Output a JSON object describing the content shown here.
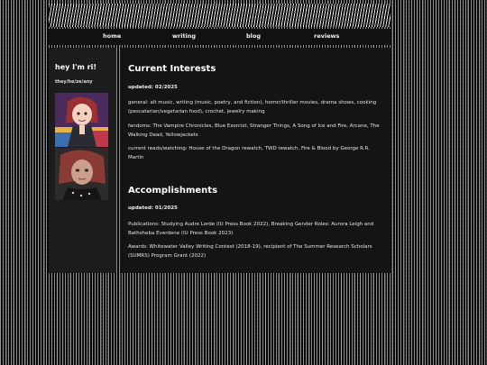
{
  "nav": {
    "items": [
      {
        "label": "home"
      },
      {
        "label": "writing"
      },
      {
        "label": "blog"
      },
      {
        "label": "reviews"
      }
    ]
  },
  "sidebar": {
    "name": "hey I'm ri!",
    "pronouns": "they/he/ze/any"
  },
  "interests": {
    "title": "Current Interests",
    "updated": "updated: 02/2025",
    "general": "general: alt music, writing (music, poetry, and fiction), horror/thriller movies, drama shows, cooking (pescatarian/vegetarian food), crochet, jewelry making",
    "fandoms": "fandoms: The Vampire Chronicles, Blue Exorcist, Stranger Things, A Song of Ice and Fire, Arcane, The Walking Dead, Yellowjackets",
    "current": "current reads/watching: House of the Dragon rewatch, TWD rewatch, Fire & Blood by George R.R. Martin"
  },
  "accomplishments": {
    "title": "Accomplishments",
    "updated": "updated: 01/2025",
    "publications": "Publications: Studying Audre Lorde (IU Press Book 2022), Breaking Gender Roles: Aurora Leigh and Bathsheba Everdene (IU Press Book 2023)",
    "awards": "Awards: Whitewater Valley Writing Contest (2018-19), recipient of The Summer Research Scholars (SUMRS) Program Grant (2022)"
  }
}
